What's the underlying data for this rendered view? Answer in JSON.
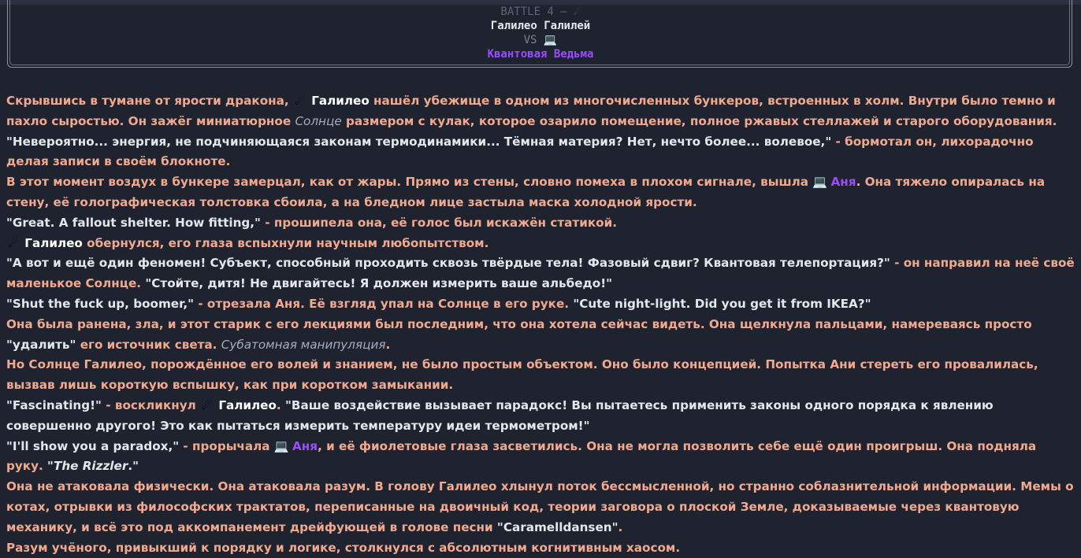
{
  "battle": {
    "title": "BATTLE 4 – ",
    "title_emoji": "☄",
    "player1": "Галилео Галилей",
    "vs": "VS ",
    "vs_emoji": "💻",
    "player2": "Квантовая Ведьма"
  },
  "colors": {
    "narration": "#f0a98e",
    "dialogue": "#e4e6ea",
    "galileo": "#ffffff",
    "anya": "#9a4dff",
    "background": "#1f2330"
  },
  "icons": {
    "galileo": "comet-icon",
    "anya": "laptop-icon"
  },
  "story": [
    [
      {
        "t": "n",
        "v": "Скрывшись в тумане от ярости дракона, "
      },
      {
        "t": "e",
        "v": "☄"
      },
      {
        "t": "g",
        "v": " Галилео"
      },
      {
        "t": "n",
        "v": " нашёл убежище в одном из многочисленных бункеров, встроенных в холм. Внутри было темно и пахло сыростью. Он зажёг миниатюрное "
      },
      {
        "t": "i",
        "v": "Солнце"
      },
      {
        "t": "n",
        "v": " размером с кулак, которое озарило помещение, полное ржавых стеллажей и старого оборудования."
      }
    ],
    [
      {
        "t": "q",
        "v": "\"Невероятно... энергия, не подчиняющаяся законам термодинамики... Тёмная материя? Нет, нечто более... волевое,\""
      },
      {
        "t": "n",
        "v": " - бормотал он, лихорадочно делая записи в своём блокноте."
      }
    ],
    [
      {
        "t": "n",
        "v": "В этот момент воздух в бункере замерцал, как от жары. Прямо из стены, словно помеха в плохом сигнале, вышла "
      },
      {
        "t": "e",
        "v": "💻"
      },
      {
        "t": "a",
        "v": " Аня"
      },
      {
        "t": "n",
        "v": ". Она тяжело опиралась на стену, её голографическая толстовка сбоила, а на бледном лице застыла маска холодной ярости."
      }
    ],
    [
      {
        "t": "q",
        "v": "\"Great. A fallout shelter. How fitting,\""
      },
      {
        "t": "n",
        "v": " - прошипела она, её голос был искажён статикой."
      }
    ],
    [
      {
        "t": "e",
        "v": "☄"
      },
      {
        "t": "g",
        "v": " Галилео"
      },
      {
        "t": "n",
        "v": " обернулся, его глаза вспыхнули научным любопытством."
      }
    ],
    [
      {
        "t": "q",
        "v": "\"А вот и ещё один феномен! Субъект, способный проходить сквозь твёрдые тела! Фазовый сдвиг? Квантовая телепортация?\""
      },
      {
        "t": "n",
        "v": " - он направил на неё своё маленькое Солнце. "
      },
      {
        "t": "q",
        "v": "\"Стойте, дитя! Не двигайтесь! Я должен измерить ваше альбедо!\""
      }
    ],
    [
      {
        "t": "q",
        "v": "\"Shut the fuck up, boomer,\""
      },
      {
        "t": "n",
        "v": " - отрезала Аня. Её взгляд упал на Солнце в его руке. "
      },
      {
        "t": "q",
        "v": "\"Cute night-light. Did you get it from IKEA?\""
      }
    ],
    [
      {
        "t": "n",
        "v": "Она была ранена, зла, и этот старик с его лекциями был последним, что она хотела сейчас видеть. Она щелкнула пальцами, намереваясь просто "
      },
      {
        "t": "q",
        "v": "\"удалить\""
      },
      {
        "t": "n",
        "v": " его источник света. "
      },
      {
        "t": "i",
        "v": "Субатомная манипуляция"
      },
      {
        "t": "n",
        "v": "."
      }
    ],
    [
      {
        "t": "n",
        "v": "Но Солнце Галилео, порождённое его волей и знанием, не было простым объектом. Оно было концепцией. Попытка Ани стереть его провалилась, вызвав лишь короткую вспышку, как при коротком замыкании."
      }
    ],
    [
      {
        "t": "q",
        "v": "\"Fascinating!\""
      },
      {
        "t": "n",
        "v": " - воскликнул "
      },
      {
        "t": "e",
        "v": "☄"
      },
      {
        "t": "g",
        "v": " Галилео"
      },
      {
        "t": "n",
        "v": ". "
      },
      {
        "t": "q",
        "v": "\"Ваше воздействие вызывает парадокс! Вы пытаетесь применить законы одного порядка к явлению совершенно другого! Это как пытаться измерить температуру идеи термометром!\""
      }
    ],
    [
      {
        "t": "q",
        "v": "\"I'll show you a paradox,\""
      },
      {
        "t": "n",
        "v": " - прорычала "
      },
      {
        "t": "e",
        "v": "💻"
      },
      {
        "t": "a",
        "v": " Аня"
      },
      {
        "t": "n",
        "v": ", и её фиолетовые глаза засветились. Она не могла позволить себе ещё один проигрыш. Она подняла руку. "
      },
      {
        "t": "q",
        "v": "\""
      },
      {
        "t": "qi",
        "v": "The Rizzler"
      },
      {
        "t": "q",
        "v": ".\""
      }
    ],
    [
      {
        "t": "n",
        "v": "Она не атаковала физически. Она атаковала разум. В голову Галилео хлынул поток бессмысленной, но странно соблазнительной информации. Мемы о котах, отрывки из философских трактатов, переписанные на двоичный код, теории заговора о плоской Земле, доказываемые через квантовую механику, и всё это под аккомпанемент дрейфующей в голове песни "
      },
      {
        "t": "q",
        "v": "\"Caramelldansen\""
      },
      {
        "t": "n",
        "v": "."
      }
    ],
    [
      {
        "t": "n",
        "v": "Разум учёного, привыкший к порядку и логике, столкнулся с абсолютным когнитивным хаосом."
      }
    ]
  ]
}
